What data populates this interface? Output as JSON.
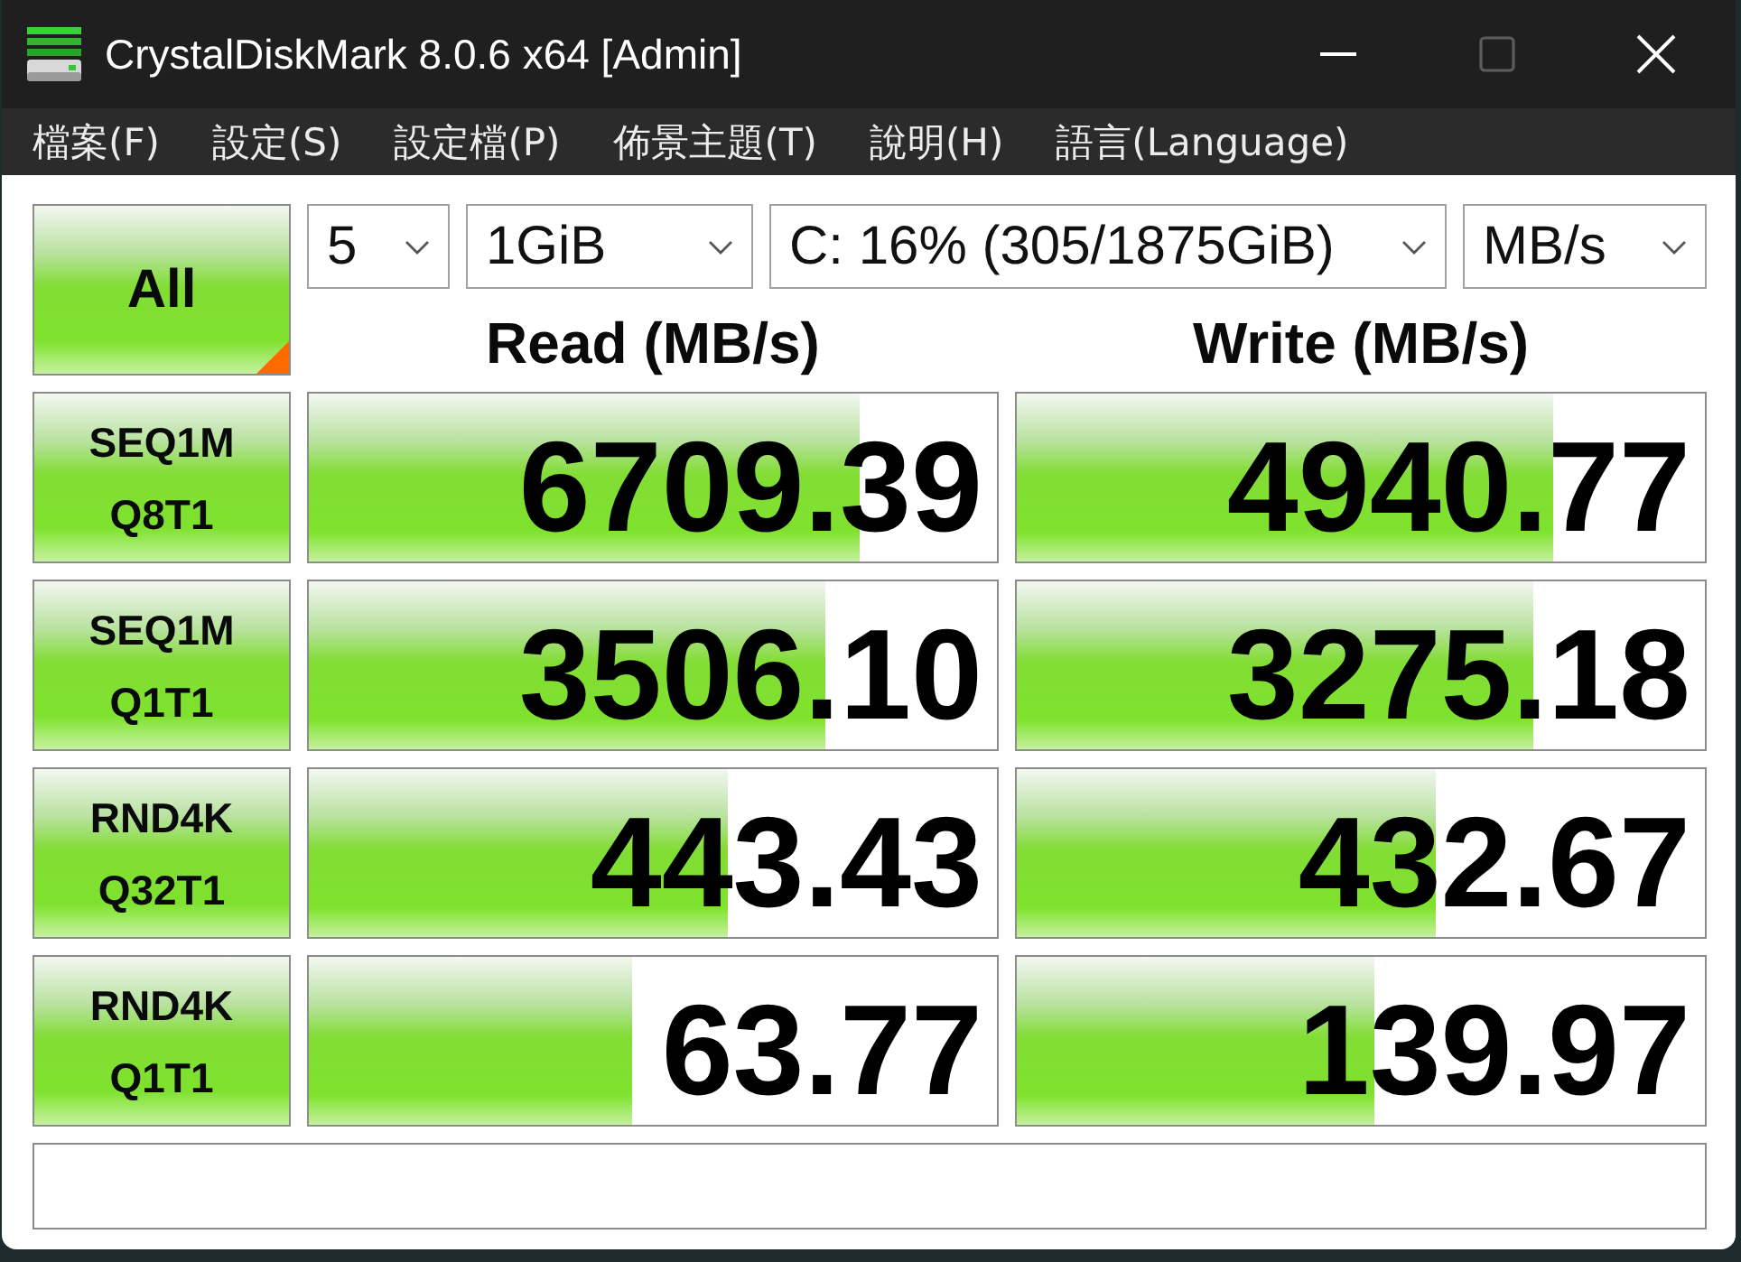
{
  "window": {
    "title": "CrystalDiskMark 8.0.6 x64 [Admin]",
    "controls": [
      {
        "kind": "minimize",
        "disabled": false
      },
      {
        "kind": "maximize",
        "disabled": true
      },
      {
        "kind": "close",
        "disabled": false
      }
    ]
  },
  "menu": [
    {
      "label": "檔案(F)"
    },
    {
      "label": "設定(S)"
    },
    {
      "label": "設定檔(P)"
    },
    {
      "label": "佈景主題(T)"
    },
    {
      "label": "說明(H)"
    },
    {
      "label": "語言(Language)"
    }
  ],
  "all_button": {
    "label": "All"
  },
  "settings": [
    {
      "value": "5"
    },
    {
      "value": "1GiB"
    },
    {
      "value": "C: 16% (305/1875GiB)"
    },
    {
      "value": "MB/s"
    }
  ],
  "columns": [
    "Read (MB/s)",
    "Write (MB/s)"
  ],
  "tests": [
    {
      "label": "SEQ1M",
      "sublabel": "Q8T1",
      "read": {
        "value": "6709.39",
        "level": 0.8
      },
      "write": {
        "value": "4940.77",
        "level": 0.78
      }
    },
    {
      "label": "SEQ1M",
      "sublabel": "Q1T1",
      "read": {
        "value": "3506.10",
        "level": 0.75
      },
      "write": {
        "value": "3275.18",
        "level": 0.75
      }
    },
    {
      "label": "RND4K",
      "sublabel": "Q32T1",
      "read": {
        "value": "443.43",
        "level": 0.61
      },
      "write": {
        "value": "432.67",
        "level": 0.61
      }
    },
    {
      "label": "RND4K",
      "sublabel": "Q1T1",
      "read": {
        "value": "63.77",
        "level": 0.47
      },
      "write": {
        "value": "139.97",
        "level": 0.52
      }
    }
  ]
}
